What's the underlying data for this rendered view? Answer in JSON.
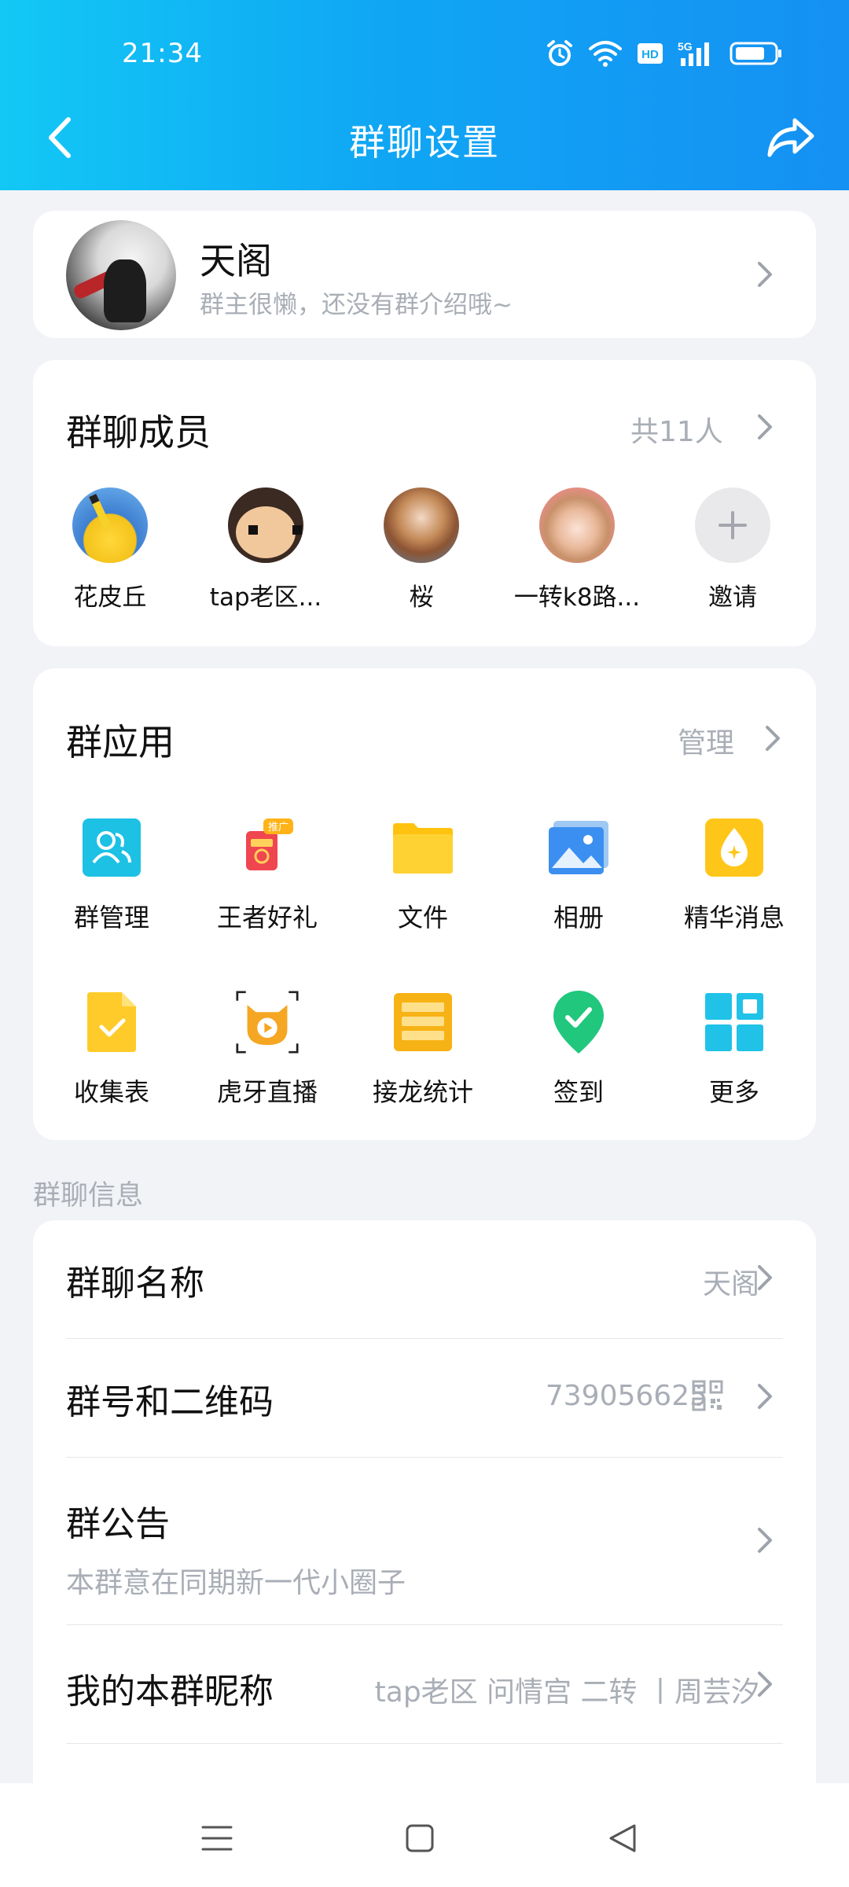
{
  "status_bar": {
    "time": "21:34",
    "icons": [
      "alarm-icon",
      "wifi-icon",
      "hd-icon",
      "5g-signal-icon",
      "battery-icon"
    ],
    "hd_label": "HD",
    "net_label": "5G"
  },
  "header": {
    "title": "群聊设置",
    "back_icon": "chevron-left-icon",
    "share_icon": "share-icon"
  },
  "group": {
    "name": "天阁",
    "description": "群主很懒，还没有群介绍哦~"
  },
  "members": {
    "title": "群聊成员",
    "count": "共11人",
    "list": [
      {
        "name": "花皮丘"
      },
      {
        "name": "tap老区..."
      },
      {
        "name": "桜"
      },
      {
        "name": "一转k8路..."
      },
      {
        "name": "邀请"
      }
    ]
  },
  "apps": {
    "title": "群应用",
    "manage": "管理",
    "items": [
      {
        "label": "群管理",
        "icon": "group-manage-icon"
      },
      {
        "label": "王者好礼",
        "icon": "gift-icon",
        "badge": "推广"
      },
      {
        "label": "文件",
        "icon": "folder-icon"
      },
      {
        "label": "相册",
        "icon": "album-icon"
      },
      {
        "label": "精华消息",
        "icon": "highlight-icon"
      },
      {
        "label": "收集表",
        "icon": "form-icon"
      },
      {
        "label": "虎牙直播",
        "icon": "huya-live-icon"
      },
      {
        "label": "接龙统计",
        "icon": "relay-stats-icon"
      },
      {
        "label": "签到",
        "icon": "checkin-icon"
      },
      {
        "label": "更多",
        "icon": "more-grid-icon"
      }
    ]
  },
  "info": {
    "section_label": "群聊信息",
    "rows": [
      {
        "label": "群聊名称",
        "value": "天阁"
      },
      {
        "label": "群号和二维码",
        "value": "739056625"
      },
      {
        "label": "群公告",
        "value": "本群意在同期新一代小圈子"
      },
      {
        "label": "我的本群昵称",
        "value": "tap老区  问情宫  二转  丨周芸汐"
      }
    ]
  },
  "colors": {
    "header_start": "#12c8f5",
    "header_end": "#1590f3",
    "background": "#f2f3f7",
    "muted_text": "#a9aeb6"
  }
}
